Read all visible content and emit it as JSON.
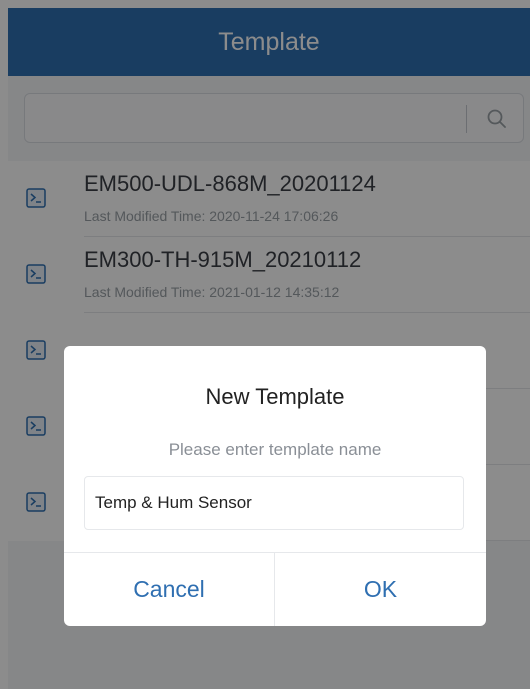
{
  "header": {
    "title": "Template"
  },
  "search": {
    "placeholder": ""
  },
  "templates": [
    {
      "name": "EM500-UDL-868M_20201124",
      "modified": "Last Modified Time: 2020-11-24 17:06:26"
    },
    {
      "name": "EM300-TH-915M_20210112",
      "modified": "Last Modified Time: 2021-01-12 14:35:12"
    },
    {
      "name": "",
      "modified": ""
    },
    {
      "name": "",
      "modified": ""
    },
    {
      "name": "",
      "modified": ""
    }
  ],
  "dialog": {
    "title": "New Template",
    "prompt": "Please enter template name",
    "input_value": "Temp & Hum Sensor",
    "cancel_label": "Cancel",
    "ok_label": "OK"
  },
  "colors": {
    "accent": "#2f6fb1",
    "overlay": "rgba(0,0,0,0.45)"
  },
  "icons": {
    "search": "search-icon",
    "template": "terminal-icon"
  }
}
